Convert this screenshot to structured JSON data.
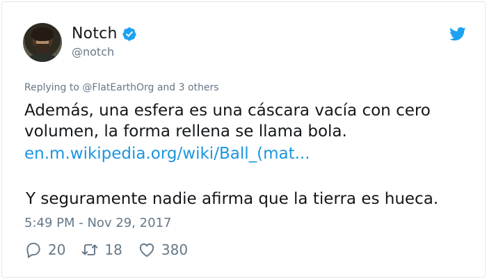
{
  "user": {
    "name": "Notch",
    "handle": "@notch"
  },
  "tweet": {
    "replying_prefix": "Replying to ",
    "replying_mention": "@FlatEarthOrg",
    "replying_suffix": " and 3 others",
    "line1": "Además, una esfera es una cáscara vacía con cero",
    "line2": "volumen, la forma rellena se llama bola.",
    "link": "en.m.wikipedia.org/wiki/Ball_(mat...",
    "line4": "Y seguramente nadie afirma que la tierra es hueca.",
    "timestamp": "5:49 PM - Nov 29, 2017"
  },
  "actions": {
    "replies": "20",
    "retweets": "18",
    "likes": "380"
  },
  "colors": {
    "link": "#1b95e0",
    "secondary_text": "#657786",
    "brand": "#1da1f2"
  },
  "icons": [
    "verified-badge-icon",
    "twitter-bird-icon",
    "reply-icon",
    "retweet-icon",
    "like-icon"
  ]
}
